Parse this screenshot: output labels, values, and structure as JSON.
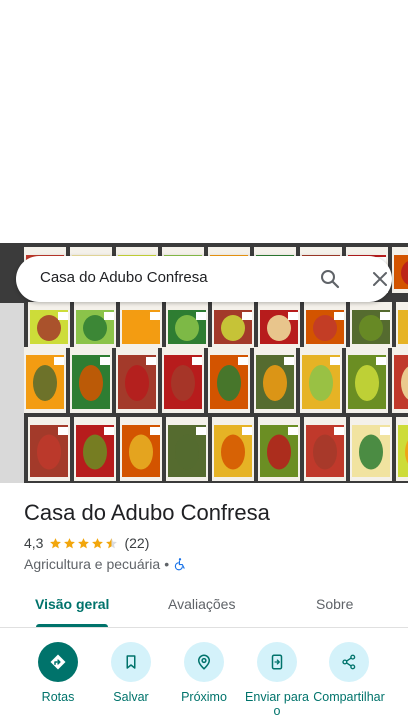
{
  "search": {
    "query": "Casa do Adubo Confresa"
  },
  "place": {
    "name": "Casa do Adubo Confresa",
    "rating": "4,3",
    "review_count": "(22)",
    "stars_value": 4.5,
    "category": "Agricultura e pecuária",
    "separator": "•"
  },
  "tabs": [
    {
      "label": "Visão geral",
      "active": true
    },
    {
      "label": "Avaliações",
      "active": false
    },
    {
      "label": "Sobre",
      "active": false
    }
  ],
  "actions": [
    {
      "label": "Rotas",
      "icon": "directions-icon"
    },
    {
      "label": "Salvar",
      "icon": "bookmark-icon"
    },
    {
      "label": "Próximo",
      "icon": "nearby-icon"
    },
    {
      "label": "Enviar para o",
      "icon": "send-to-phone-icon"
    },
    {
      "label": "Compartilhar",
      "icon": "share-icon"
    }
  ],
  "colors": {
    "accent": "#00736b",
    "star": "#f2a60c",
    "chip": "#d4f2fa"
  }
}
